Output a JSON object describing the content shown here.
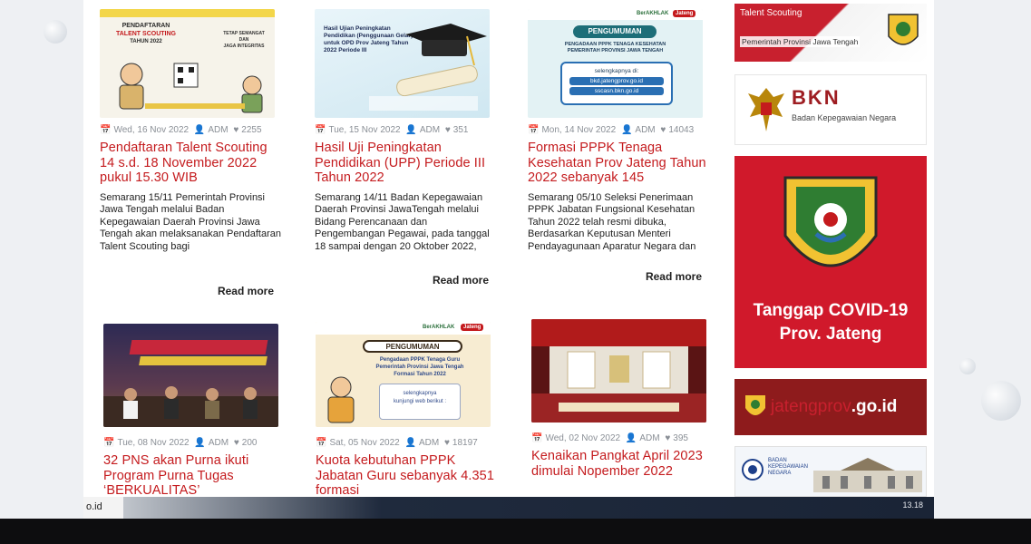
{
  "posts": [
    {
      "date": "Wed, 16 Nov 2022",
      "author": "ADM",
      "likes": "2255",
      "title": "Pendaftaran Talent Scouting 14 s.d. 18 November 2022 pukul 15.30 WIB",
      "excerpt": "Semarang 15/11 Pemerintah Provinsi Jawa Tengah melalui Badan Kepegawaian Daerah Provinsi Jawa Tengah akan melaksanakan Pendaftaran Talent Scouting bagi",
      "read_more": "Read more",
      "thumb_text": [
        "PENDAFTARAN",
        "TALENT SCOUTING",
        "TAHUN 2022",
        "TETAP SEMANGAT",
        "DAN",
        "JAGA INTEGRITAS"
      ]
    },
    {
      "date": "Tue, 15 Nov 2022",
      "author": "ADM",
      "likes": "351",
      "title": "Hasil Uji Peningkatan Pendidikan (UPP) Periode III Tahun 2022",
      "excerpt": "Semarang 14/11 Badan Kepegawaian Daerah Provinsi JawaTengah melalui Bidang Perencanaan dan Pengembangan Pegawai, pada tanggal 18 sampai dengan 20 Oktober 2022,",
      "read_more": "Read more",
      "thumb_text": [
        "Hasil Ujian Peningkatan",
        "Pendidikan (Penggunaan Gelar)",
        "untuk OPD Prov Jateng Tahun",
        "2022 Periode III"
      ]
    },
    {
      "date": "Mon, 14 Nov 2022",
      "author": "ADM",
      "likes": "14043",
      "title": "Formasi PPPK Tenaga Kesehatan Prov Jateng Tahun 2022 sebanyak 145",
      "excerpt": "Semarang 05/10 Seleksi Penerimaan PPPK Jabatan Fungsional Kesehatan Tahun 2022 telah resmi dibuka, Berdasarkan Keputusan Menteri Pendayagunaan Aparatur Negara dan",
      "read_more": "Read more",
      "thumb_text": [
        "PENGUMUMAN",
        "PENGADAAN PPPK TENAGA KESEHATAN",
        "PEMERINTAH PROVINSI JAWA TENGAH",
        "selengkapnya di:",
        "bkd.jatengprov.go.id",
        "sscasn.bkn.go.id"
      ]
    },
    {
      "date": "Tue, 08 Nov 2022",
      "author": "ADM",
      "likes": "200",
      "title": "32 PNS akan Purna ikuti Program Purna Tugas ‘BERKUALITAS’"
    },
    {
      "date": "Sat, 05 Nov 2022",
      "author": "ADM",
      "likes": "18197",
      "title": "Kuota kebutuhan PPPK Jabatan Guru sebanyak 4.351 formasi",
      "thumb_text": [
        "PENGUMUMAN",
        "Pengadaan PPPK Tenaga Guru",
        "Pemerintah Provinsi Jawa Tengah",
        "Formasi Tahun 2022",
        "selengkapnya",
        "kunjungi web berikut :"
      ]
    },
    {
      "date": "Wed, 02 Nov 2022",
      "author": "ADM",
      "likes": "395",
      "title": "Kenaikan Pangkat April 2023 dimulai Nopember 2022"
    }
  ],
  "sidebar": {
    "talent_title": "Talent Scouting",
    "talent_sub": "Pemerintah Provinsi Jawa Tengah",
    "bkn_name": "BKN",
    "bkn_full": "Badan Kepegawaian Negara",
    "covid_line1": "Tanggap COVID-19",
    "covid_line2": "Prov. Jateng",
    "jateng_a": "jatengprov",
    "jateng_b": ".go.id",
    "bkn2_line1": "BADAN",
    "bkn2_line2": "KEPEGAWAIAN",
    "bkn2_line3": "NEGARA"
  },
  "thumb_brand": {
    "berakhlak": "BerAKHLAK",
    "jateng": "Jateng"
  },
  "taskbar": {
    "url_hint": "o.id",
    "clock": "13.18"
  },
  "colors": {
    "title_red": "#c41a1d",
    "covid_red": "#d0192b",
    "jateng_maroon": "#8e1b1c"
  }
}
